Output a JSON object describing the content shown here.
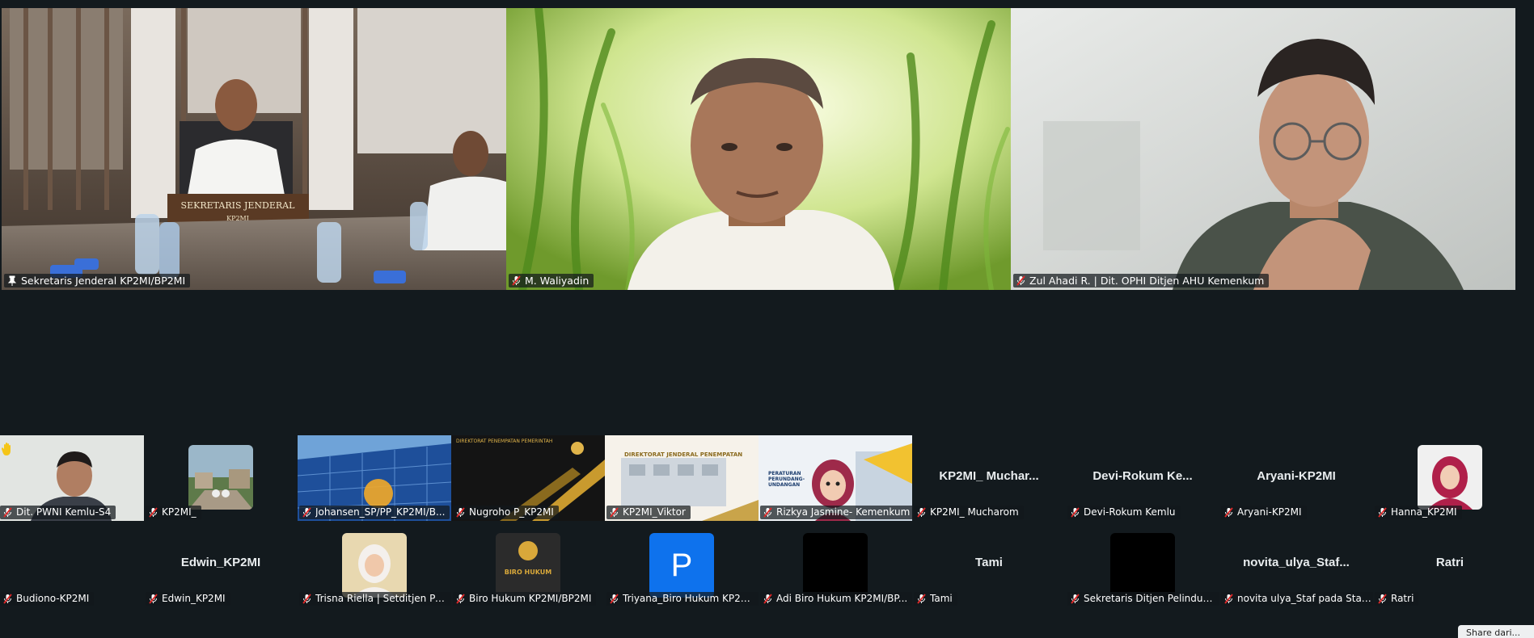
{
  "speakers": [
    {
      "name": "Sekretaris Jenderal KP2MI/BP2MI",
      "nameplate": "SEKRETARIS JENDERAL",
      "nameplate_sub": "KP2MI",
      "active": true,
      "pinned": true
    },
    {
      "name": "M. Waliyadin",
      "active": false,
      "pinned": false
    },
    {
      "name": "Zul Ahadi R. | Dit. OPHI Ditjen AHU Kemenkum",
      "active": false,
      "pinned": false
    }
  ],
  "gallery_row1": [
    {
      "label": "Dit. PWNI Kemlu-S4",
      "display": "video",
      "hand_raised": true
    },
    {
      "label": "KP2MI_",
      "display": "photo"
    },
    {
      "label": "Johansen_SP/PP_KP2MI/B...",
      "display": "video"
    },
    {
      "label": "Nugroho P_KP2MI",
      "display": "video",
      "banner": "DIREKTORAT PENEMPATAN PEMERINTAH"
    },
    {
      "label": "KP2MI_Viktor",
      "display": "video",
      "banner": "DIREKTORAT JENDERAL PENEMPATAN"
    },
    {
      "label": "Rizkya Jasmine- Kemenkum",
      "display": "video",
      "banner": "PERATURAN PERUNDANG-UNDANGAN"
    },
    {
      "label": "KP2MI_ Mucharom",
      "display": "name",
      "big_name": "KP2MI_ Muchar..."
    },
    {
      "label": "Devi-Rokum Kemlu",
      "display": "name",
      "big_name": "Devi-Rokum Ke..."
    },
    {
      "label": "Aryani-KP2MI",
      "display": "name",
      "big_name": "Aryani-KP2MI"
    },
    {
      "label": "Hanna_KP2MI",
      "display": "photo"
    }
  ],
  "gallery_row2": [
    {
      "label": "Budiono-KP2MI",
      "display": "blank"
    },
    {
      "label": "Edwin_KP2MI",
      "display": "name",
      "big_name": "Edwin_KP2MI"
    },
    {
      "label": "Trisna Riella | Setditjen Pe...",
      "display": "photo"
    },
    {
      "label": "Biro Hukum KP2MI/BP2MI",
      "display": "photo",
      "logo_text": "BIRO HUKUM"
    },
    {
      "label": "Triyana_Biro Hukum KP2M...",
      "display": "letter",
      "letter": "P",
      "color": "#0e72ed"
    },
    {
      "label": "Adi Biro Hukum KP2MI/BP...",
      "display": "black"
    },
    {
      "label": "Tami",
      "display": "name",
      "big_name": "Tami"
    },
    {
      "label": "Sekretaris Ditjen Pelindun...",
      "display": "black"
    },
    {
      "label": "novita ulya_Staf pada Staf...",
      "display": "name",
      "big_name": "novita_ulya_Staf..."
    },
    {
      "label": "Ratri",
      "display": "name",
      "big_name": "Ratri"
    }
  ],
  "share_button": {
    "label": "Share dari..."
  },
  "colors": {
    "active_speaker": "#23d959",
    "background": "#131a1e",
    "mute": "#e02828"
  }
}
